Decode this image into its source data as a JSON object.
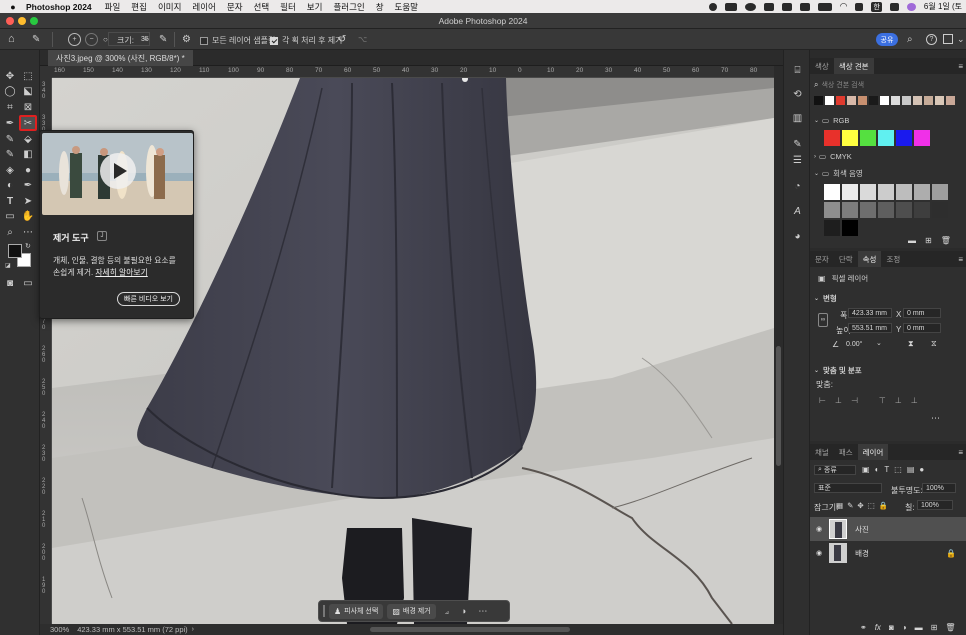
{
  "menubar": {
    "app_name": "Photoshop 2024",
    "items": [
      "파일",
      "편집",
      "이미지",
      "레이어",
      "문자",
      "선택",
      "필터",
      "보기",
      "플러그인",
      "창",
      "도움말"
    ],
    "clock": "6월 1일 (토"
  },
  "window": {
    "title": "Adobe Photoshop 2024"
  },
  "options_bar": {
    "size_label": "크기:",
    "size_value": "35",
    "sample_all_layers": "모든 레이어 샘플링",
    "remove_after_stroke": "각 획 처리 후 제거",
    "share": "공유"
  },
  "document": {
    "tab_title": "사진3.jpeg @ 300% (사진, RGB/8*) *",
    "ruler_h": [
      "160",
      "150",
      "140",
      "130",
      "120",
      "110",
      "100",
      "90",
      "80",
      "70",
      "60",
      "50",
      "40",
      "30",
      "20",
      "10",
      "0",
      "10",
      "20",
      "30",
      "40",
      "50",
      "60",
      "70",
      "80",
      "90",
      "100",
      "110"
    ],
    "ruler_v": [
      "340",
      "330",
      "320",
      "310",
      "300",
      "290",
      "280",
      "270",
      "260",
      "250",
      "240",
      "230",
      "220",
      "210",
      "200",
      "190"
    ]
  },
  "status_bar": {
    "zoom": "300%",
    "doc_info": "423.33 mm x 553.51 mm (72 ppi)"
  },
  "taskbar": {
    "select_subject": "피사체 선택",
    "remove_background": "배경 제거"
  },
  "popup": {
    "title": "제거 도구",
    "body_line1": "개체, 인물, 결함 등의 불필요한 요소를",
    "body_line2": "손쉽게 제거.",
    "learn_more": "자세히 알아보기",
    "video_button": "빠른 비디오 보기"
  },
  "swatches_panel": {
    "tabs": [
      "색상",
      "색상 견본"
    ],
    "search_placeholder": "색상 견본 검색",
    "groups": [
      "RGB",
      "CMYK",
      "회색 음영"
    ],
    "recent_colors": [
      "#111111",
      "#ffffff",
      "#e03a2e",
      "#d8b8a8",
      "#c89070",
      "#1a1a1a",
      "#ffffff",
      "#dcdcdc",
      "#c8c8c8",
      "#d4c2b4",
      "#c6ab98",
      "#d9c7b7",
      "#c9a898"
    ],
    "rgb_colors": [
      "#e8312b",
      "#ffff40",
      "#55e040",
      "#60f0f0",
      "#1a1aee",
      "#f030e8"
    ],
    "gray_colors": [
      "#ffffff",
      "#ececec",
      "#dadada",
      "#cccccc",
      "#bdbdbd",
      "#adadad",
      "#9e9e9e",
      "#8e8e8e",
      "#7e7e7e",
      "#6e6e6e",
      "#5e5e5e",
      "#4e4e4e",
      "#3e3e3e",
      "#2e2e2e",
      "#1e1e1e",
      "#000000"
    ]
  },
  "properties_panel": {
    "tabs": [
      "문자",
      "단락",
      "속성",
      "조정"
    ],
    "kind": "픽셀 레이어",
    "transform_label": "변형",
    "width_label": "폭",
    "width_value": "423.33 mm",
    "height_label": "높이",
    "height_value": "553.51 mm",
    "x_label": "X",
    "x_value": "0 mm",
    "y_label": "Y",
    "y_value": "0 mm",
    "angle_value": "0.00°",
    "align_label": "맞춤 및 분포",
    "align_sub": "맞춤:"
  },
  "layers_panel": {
    "tabs": [
      "채널",
      "패스",
      "레이어"
    ],
    "filter": "종류",
    "blend_mode": "표준",
    "opacity_label": "불투명도:",
    "opacity_value": "100%",
    "lock_label": "잠그기:",
    "fill_label": "칠:",
    "fill_value": "100%",
    "layers": [
      {
        "name": "사진",
        "selected": true
      },
      {
        "name": "배경",
        "selected": false
      }
    ]
  }
}
